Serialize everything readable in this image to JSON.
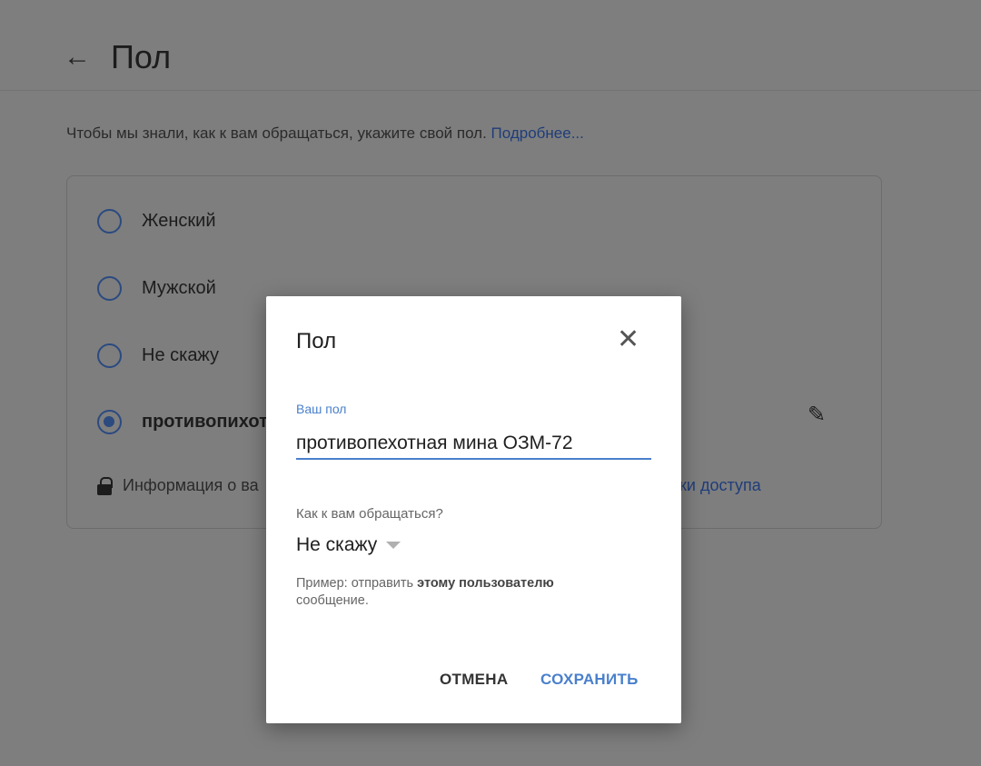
{
  "page": {
    "title": "Пол",
    "intro": "Чтобы мы знали, как к вам обращаться, укажите свой пол.",
    "learn_more": "Подробнее...",
    "options": [
      "Женский",
      "Мужской",
      "Не скажу",
      "противопихот"
    ],
    "info_text": "Информация о ва",
    "access_link": "йки доступа"
  },
  "dialog": {
    "title": "Пол",
    "field_label": "Ваш пол",
    "field_value": "противопехотная мина ОЗМ-72",
    "address_label": "Как к вам обращаться?",
    "address_value": "Не скажу",
    "hint_prefix": "Пример: отправить ",
    "hint_bold": "этому пользователю",
    "hint_suffix": " сообщение.",
    "cancel": "ОТМЕНА",
    "save": "СОХРАНИТЬ"
  },
  "colors": {
    "accent": "#4a80cc",
    "overlay": "#7e7e7e"
  }
}
